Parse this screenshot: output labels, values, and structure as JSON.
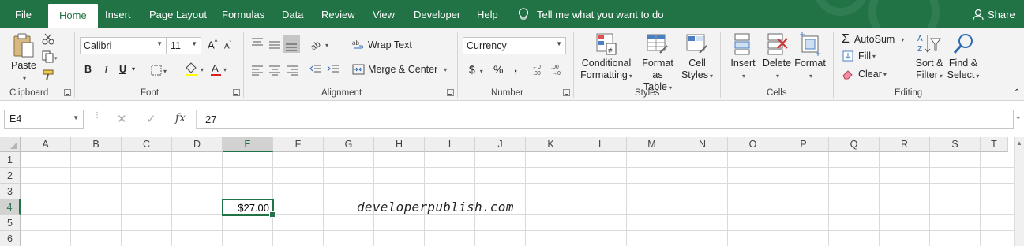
{
  "colors": {
    "brand": "#217346",
    "ribbon_bg": "#f3f3f3",
    "active_cell_border": "#217346"
  },
  "tabs": {
    "file": "File",
    "home": "Home",
    "insert": "Insert",
    "page_layout": "Page Layout",
    "formulas": "Formulas",
    "data": "Data",
    "review": "Review",
    "view": "View",
    "developer": "Developer",
    "help": "Help"
  },
  "tell_me": {
    "text": "Tell me what you want to do",
    "icon": "lightbulb-icon"
  },
  "share": {
    "label": "Share",
    "icon": "person-icon"
  },
  "ribbon": {
    "clipboard": {
      "group_label": "Clipboard",
      "paste_label": "Paste"
    },
    "font": {
      "group_label": "Font",
      "font_name": "Calibri",
      "font_size": "11",
      "bold": "B",
      "italic": "I",
      "underline": "U"
    },
    "alignment": {
      "group_label": "Alignment",
      "wrap_text": "Wrap Text",
      "merge_center": "Merge & Center"
    },
    "number": {
      "group_label": "Number",
      "format": "Currency",
      "currency_symbol": "$",
      "percent_symbol": "%",
      "comma_symbol": ","
    },
    "styles": {
      "group_label": "Styles",
      "conditional_1": "Conditional",
      "conditional_2": "Formatting",
      "format_as_1": "Format as",
      "format_as_2": "Table",
      "cell_styles_1": "Cell",
      "cell_styles_2": "Styles"
    },
    "cells": {
      "group_label": "Cells",
      "insert": "Insert",
      "delete": "Delete",
      "format": "Format"
    },
    "editing": {
      "group_label": "Editing",
      "autosum": "AutoSum",
      "fill": "Fill",
      "clear": "Clear",
      "sort_1": "Sort &",
      "sort_2": "Filter",
      "find_1": "Find &",
      "find_2": "Select"
    }
  },
  "formula_bar": {
    "name_box": "E4",
    "fx": "fx",
    "formula": "27"
  },
  "grid": {
    "columns": [
      "A",
      "B",
      "C",
      "D",
      "E",
      "F",
      "G",
      "H",
      "I",
      "J",
      "K",
      "L",
      "M",
      "N",
      "O",
      "P",
      "Q",
      "R",
      "S",
      "T"
    ],
    "rows": [
      "1",
      "2",
      "3",
      "4",
      "5",
      "6"
    ],
    "selected_column": "E",
    "selected_row": "4",
    "active_cell": {
      "ref": "E4",
      "display": "$27.00"
    },
    "watermark": "developerpublish.com"
  }
}
